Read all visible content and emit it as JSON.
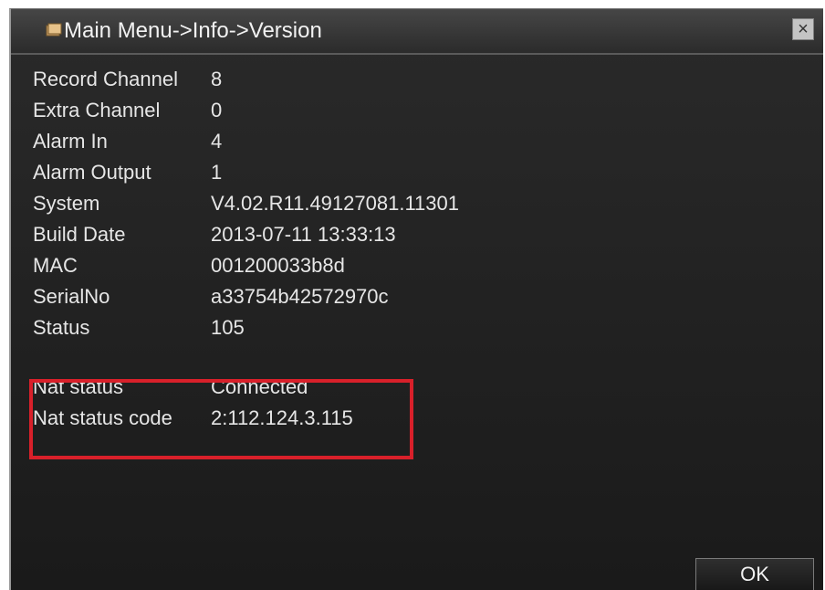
{
  "window": {
    "title": "Main Menu->Info->Version",
    "close_label": "×",
    "ok_label": "OK"
  },
  "info": [
    {
      "label": "Record Channel",
      "value": "8"
    },
    {
      "label": "Extra Channel",
      "value": "0"
    },
    {
      "label": "Alarm In",
      "value": "4"
    },
    {
      "label": "Alarm Output",
      "value": "1"
    },
    {
      "label": "System",
      "value": "V4.02.R11.49127081.11301"
    },
    {
      "label": "Build Date",
      "value": "2013-07-11 13:33:13"
    },
    {
      "label": "MAC",
      "value": "001200033b8d"
    },
    {
      "label": "SerialNo",
      "value": "a33754b42572970c"
    },
    {
      "label": "Status",
      "value": "105"
    }
  ],
  "nat": [
    {
      "label": "Nat status",
      "value": "Connected"
    },
    {
      "label": "Nat status code",
      "value": "2:112.124.3.115"
    }
  ],
  "colors": {
    "background": "#1f1f1f",
    "text": "#e6e6e6",
    "highlight_border": "#d8202a"
  },
  "icons": {
    "title_icon": "menu-icon",
    "close_icon": "close-icon"
  }
}
